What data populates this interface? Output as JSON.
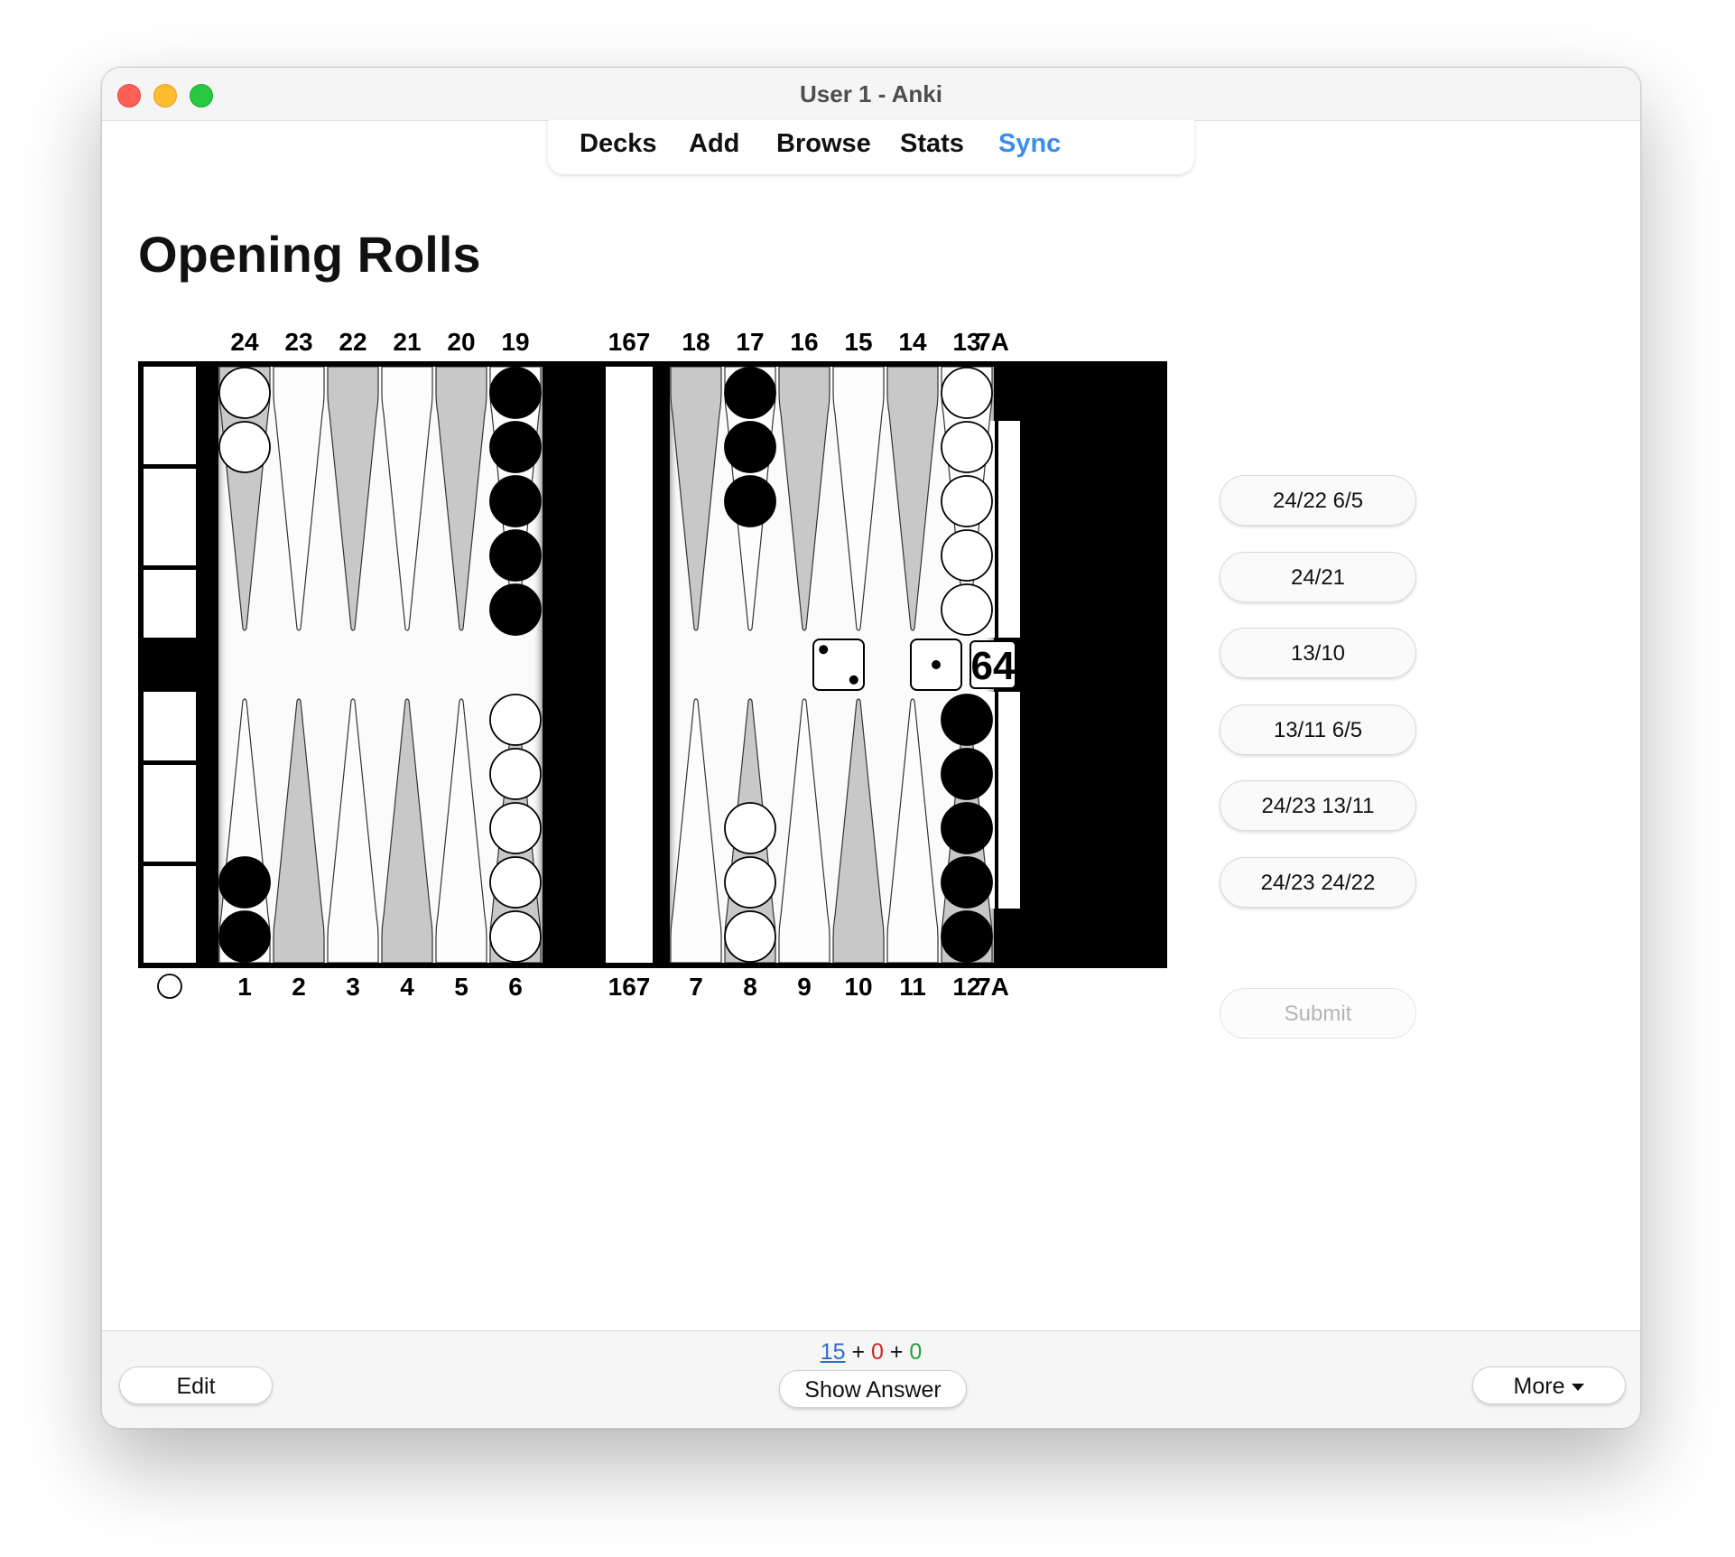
{
  "window": {
    "title": "User 1 - Anki"
  },
  "toolbar": {
    "items": [
      "Decks",
      "Add",
      "Browse",
      "Stats",
      "Sync"
    ],
    "active_color": "#3a8de8"
  },
  "card": {
    "title": "Opening Rolls"
  },
  "board": {
    "top_labels": [
      "24",
      "23",
      "22",
      "21",
      "20",
      "19",
      "167",
      "18",
      "17",
      "16",
      "15",
      "14",
      "13",
      "7A"
    ],
    "bottom_labels": [
      "1",
      "2",
      "3",
      "4",
      "5",
      "6",
      "167",
      "7",
      "8",
      "9",
      "10",
      "11",
      "12",
      "7A"
    ],
    "cube_value": "64",
    "dice": [
      2,
      1
    ],
    "checkers": [
      {
        "point": 24,
        "color": "white",
        "count": 2
      },
      {
        "point": 19,
        "color": "black",
        "count": 5
      },
      {
        "point": 17,
        "color": "black",
        "count": 3
      },
      {
        "point": 13,
        "color": "white",
        "count": 5
      },
      {
        "point": 1,
        "color": "black",
        "count": 2
      },
      {
        "point": 6,
        "color": "white",
        "count": 5
      },
      {
        "point": 8,
        "color": "white",
        "count": 3
      },
      {
        "point": 12,
        "color": "black",
        "count": 5
      }
    ],
    "colors": {
      "point_dark": "#c8c8c8",
      "point_light": "#fdfdfd",
      "frame": "#000000"
    }
  },
  "options": [
    "24/22 6/5",
    "24/21",
    "13/10",
    "13/11 6/5",
    "24/23 13/11",
    "24/23 24/22"
  ],
  "submit_label": "Submit",
  "bottom": {
    "edit_label": "Edit",
    "show_answer_label": "Show Answer",
    "more_label": "More",
    "counts": {
      "new": "15",
      "learn": "0",
      "review": "0"
    }
  }
}
